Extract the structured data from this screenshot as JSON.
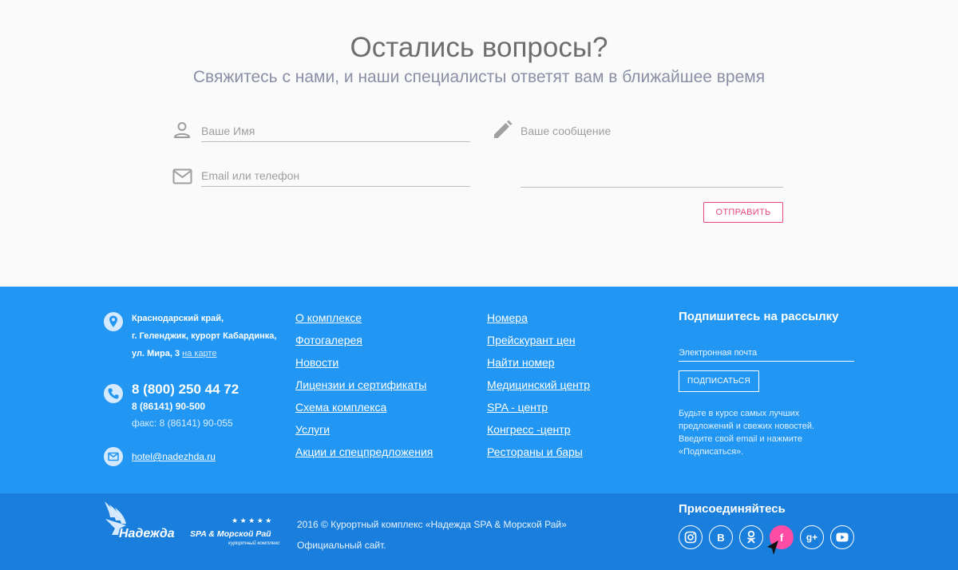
{
  "contact": {
    "title": "Остались вопросы?",
    "subtitle": "Свяжитесь с нами, и наши специалисты ответят вам в ближайшее время",
    "name_placeholder": "Ваше Имя",
    "contact_placeholder": "Email или телефон",
    "message_placeholder": "Ваше сообщение",
    "submit_label": "ОТПРАВИТЬ",
    "icons": {
      "name": "person-icon",
      "contact": "mail-icon",
      "message": "pencil-icon"
    },
    "accent_color": "#e8457c"
  },
  "footer": {
    "colors": {
      "top_bg": "#2196f3",
      "bottom_bg": "#1a7fdc",
      "active_social": "#ff4da6"
    },
    "address": {
      "line1": "Краснодарский край,",
      "line2": "г. Геленджик, курорт Кабардинка,",
      "line3": "ул. Мира, 3",
      "map_link": "на карте"
    },
    "phone_main": "8 (800) 250 44 72",
    "phone_secondary": "8 (86141) 90-500",
    "fax": "факс: 8 (86141) 90-055",
    "email": "hotel@nadezhda.ru",
    "nav_left": [
      "О комплексе",
      "Фотогалерея",
      "Новости",
      "Лицензии и сертификаты",
      "Схема комплекса",
      "Услуги",
      "Акции и спецпредложения"
    ],
    "nav_right": [
      "Номера",
      "Прейскурант цен",
      "Найти номер",
      "Медицинский центр",
      "SPA - центр",
      "Конгресс -центр",
      "Рестораны и бары"
    ],
    "newsletter": {
      "title": "Подпишитесь на рассылку",
      "email_placeholder": "Электронная почта",
      "button_label": "ПОДПИСАТЬСЯ",
      "note": "Будьте в курсе самых лучших предложений и свежих новостей. Введите свой email и нажмите «Подписаться»."
    },
    "logo": {
      "stars": "★ ★ ★ ★ ★",
      "name": "Надежда",
      "tagline": "SPA & Морской Рай",
      "sub": "курортный комплекс"
    },
    "copyright_line1": "2016 © Курортный комплекс «Надежда SPA & Морской Рай»",
    "copyright_line2": "Официальный сайт.",
    "join_title": "Присоединяйтесь",
    "socials": [
      {
        "icon": "instagram-icon",
        "glyph": ""
      },
      {
        "icon": "vk-icon",
        "glyph": "B"
      },
      {
        "icon": "odnoklassniki-icon",
        "glyph": ""
      },
      {
        "icon": "facebook-icon",
        "glyph": "f",
        "active": true
      },
      {
        "icon": "google-plus-icon",
        "glyph": "g+"
      },
      {
        "icon": "youtube-icon",
        "glyph": ""
      }
    ]
  }
}
